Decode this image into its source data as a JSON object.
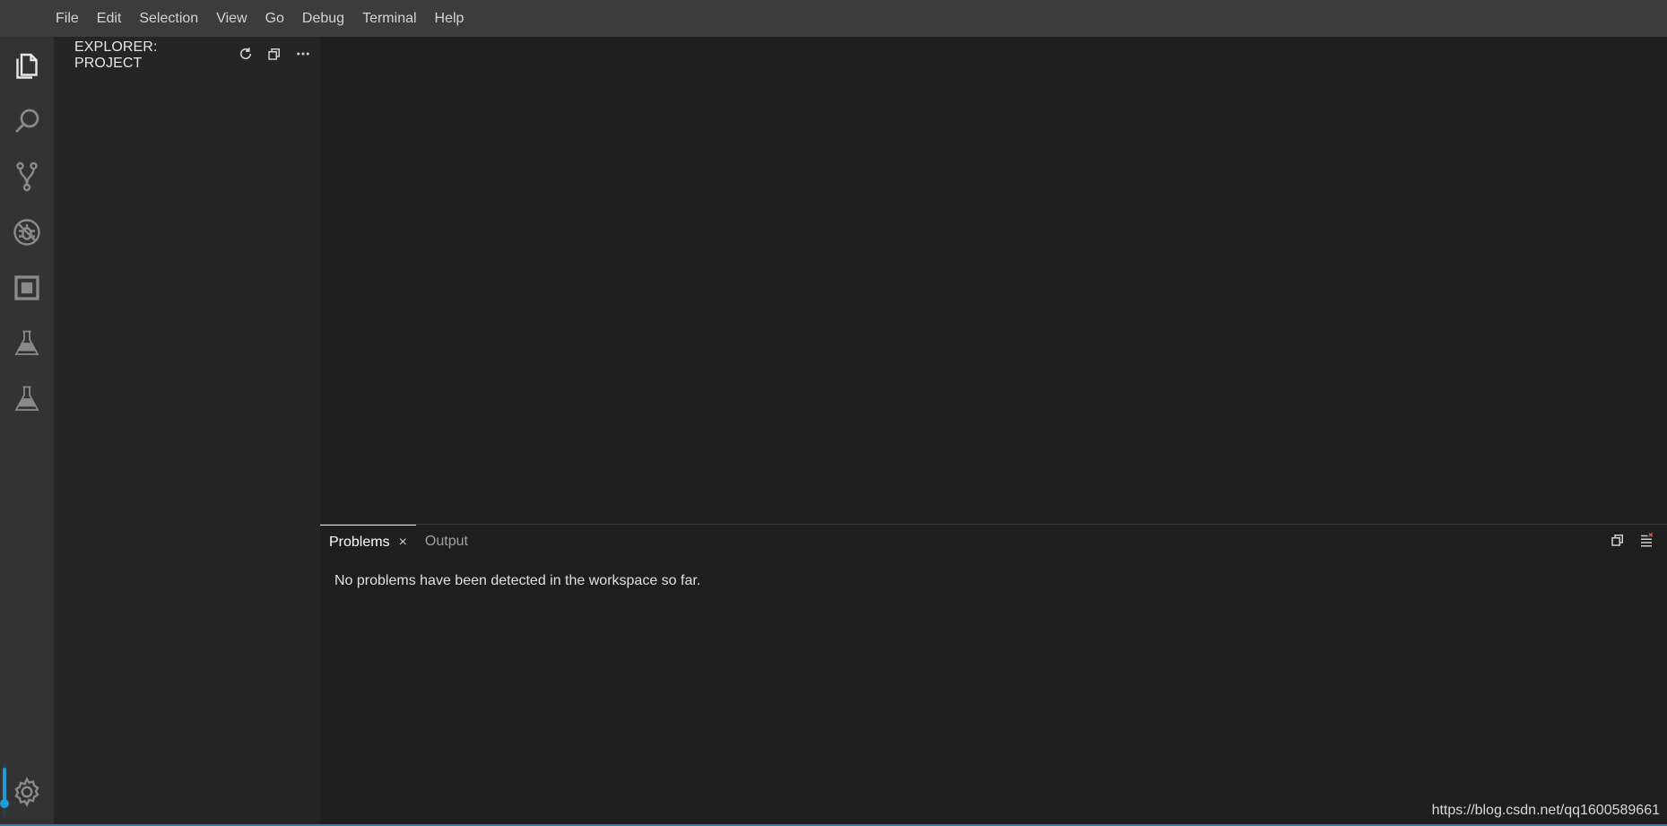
{
  "menubar": {
    "items": [
      "File",
      "Edit",
      "Selection",
      "View",
      "Go",
      "Debug",
      "Terminal",
      "Help"
    ]
  },
  "activitybar": {
    "icons": [
      "files-icon",
      "search-icon",
      "source-control-icon",
      "debug-icon",
      "extensions-icon",
      "flask-icon",
      "flask-icon"
    ],
    "settings_icon": "gear-icon",
    "slider_level": 0.75
  },
  "sidebar": {
    "title": "EXPLORER: PROJECT",
    "actions": [
      "refresh-icon",
      "collapse-all-icon",
      "more-icon"
    ]
  },
  "panel": {
    "tabs": [
      {
        "label": "Problems",
        "close": "×",
        "active": true
      },
      {
        "label": "Output",
        "active": false
      }
    ],
    "message": "No problems have been detected in the workspace so far.",
    "actions": [
      "collapse-all-icon",
      "clear-all-icon"
    ]
  },
  "watermark": "https://blog.csdn.net/qq1600589661",
  "colors": {
    "menubar": "#3c3c3c",
    "activitybar": "#333333",
    "sidebar": "#252526",
    "editor": "#1e1e1e",
    "accent": "#1e9bd7"
  }
}
